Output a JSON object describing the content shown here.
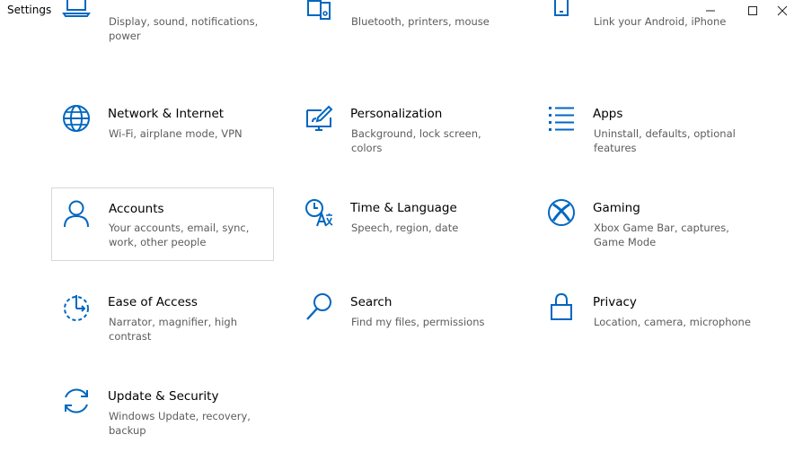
{
  "window": {
    "title": "Settings"
  },
  "tiles": [
    {
      "name": "",
      "desc": "Display, sound, notifications, power",
      "icon": "laptop-icon"
    },
    {
      "name": "",
      "desc": "Bluetooth, printers, mouse",
      "icon": "devices-icon"
    },
    {
      "name": "",
      "desc": "Link your Android, iPhone",
      "icon": "phone-icon"
    },
    {
      "name": "Network & Internet",
      "desc": "Wi-Fi, airplane mode, VPN",
      "icon": "globe-icon"
    },
    {
      "name": "Personalization",
      "desc": "Background, lock screen, colors",
      "icon": "paint-icon"
    },
    {
      "name": "Apps",
      "desc": "Uninstall, defaults, optional features",
      "icon": "apps-list-icon"
    },
    {
      "name": "Accounts",
      "desc": "Your accounts, email, sync, work, other people",
      "icon": "person-icon"
    },
    {
      "name": "Time & Language",
      "desc": "Speech, region, date",
      "icon": "time-language-icon"
    },
    {
      "name": "Gaming",
      "desc": "Xbox Game Bar, captures, Game Mode",
      "icon": "xbox-icon"
    },
    {
      "name": "Ease of Access",
      "desc": "Narrator, magnifier, high contrast",
      "icon": "ease-of-access-icon"
    },
    {
      "name": "Search",
      "desc": "Find my files, permissions",
      "icon": "search-icon"
    },
    {
      "name": "Privacy",
      "desc": "Location, camera, microphone",
      "icon": "lock-icon"
    },
    {
      "name": "Update & Security",
      "desc": "Windows Update, recovery, backup",
      "icon": "sync-icon"
    }
  ],
  "colors": {
    "accent": "#0067c0",
    "description": "#5c5c5c",
    "selected_border": "#d8d8d8"
  }
}
